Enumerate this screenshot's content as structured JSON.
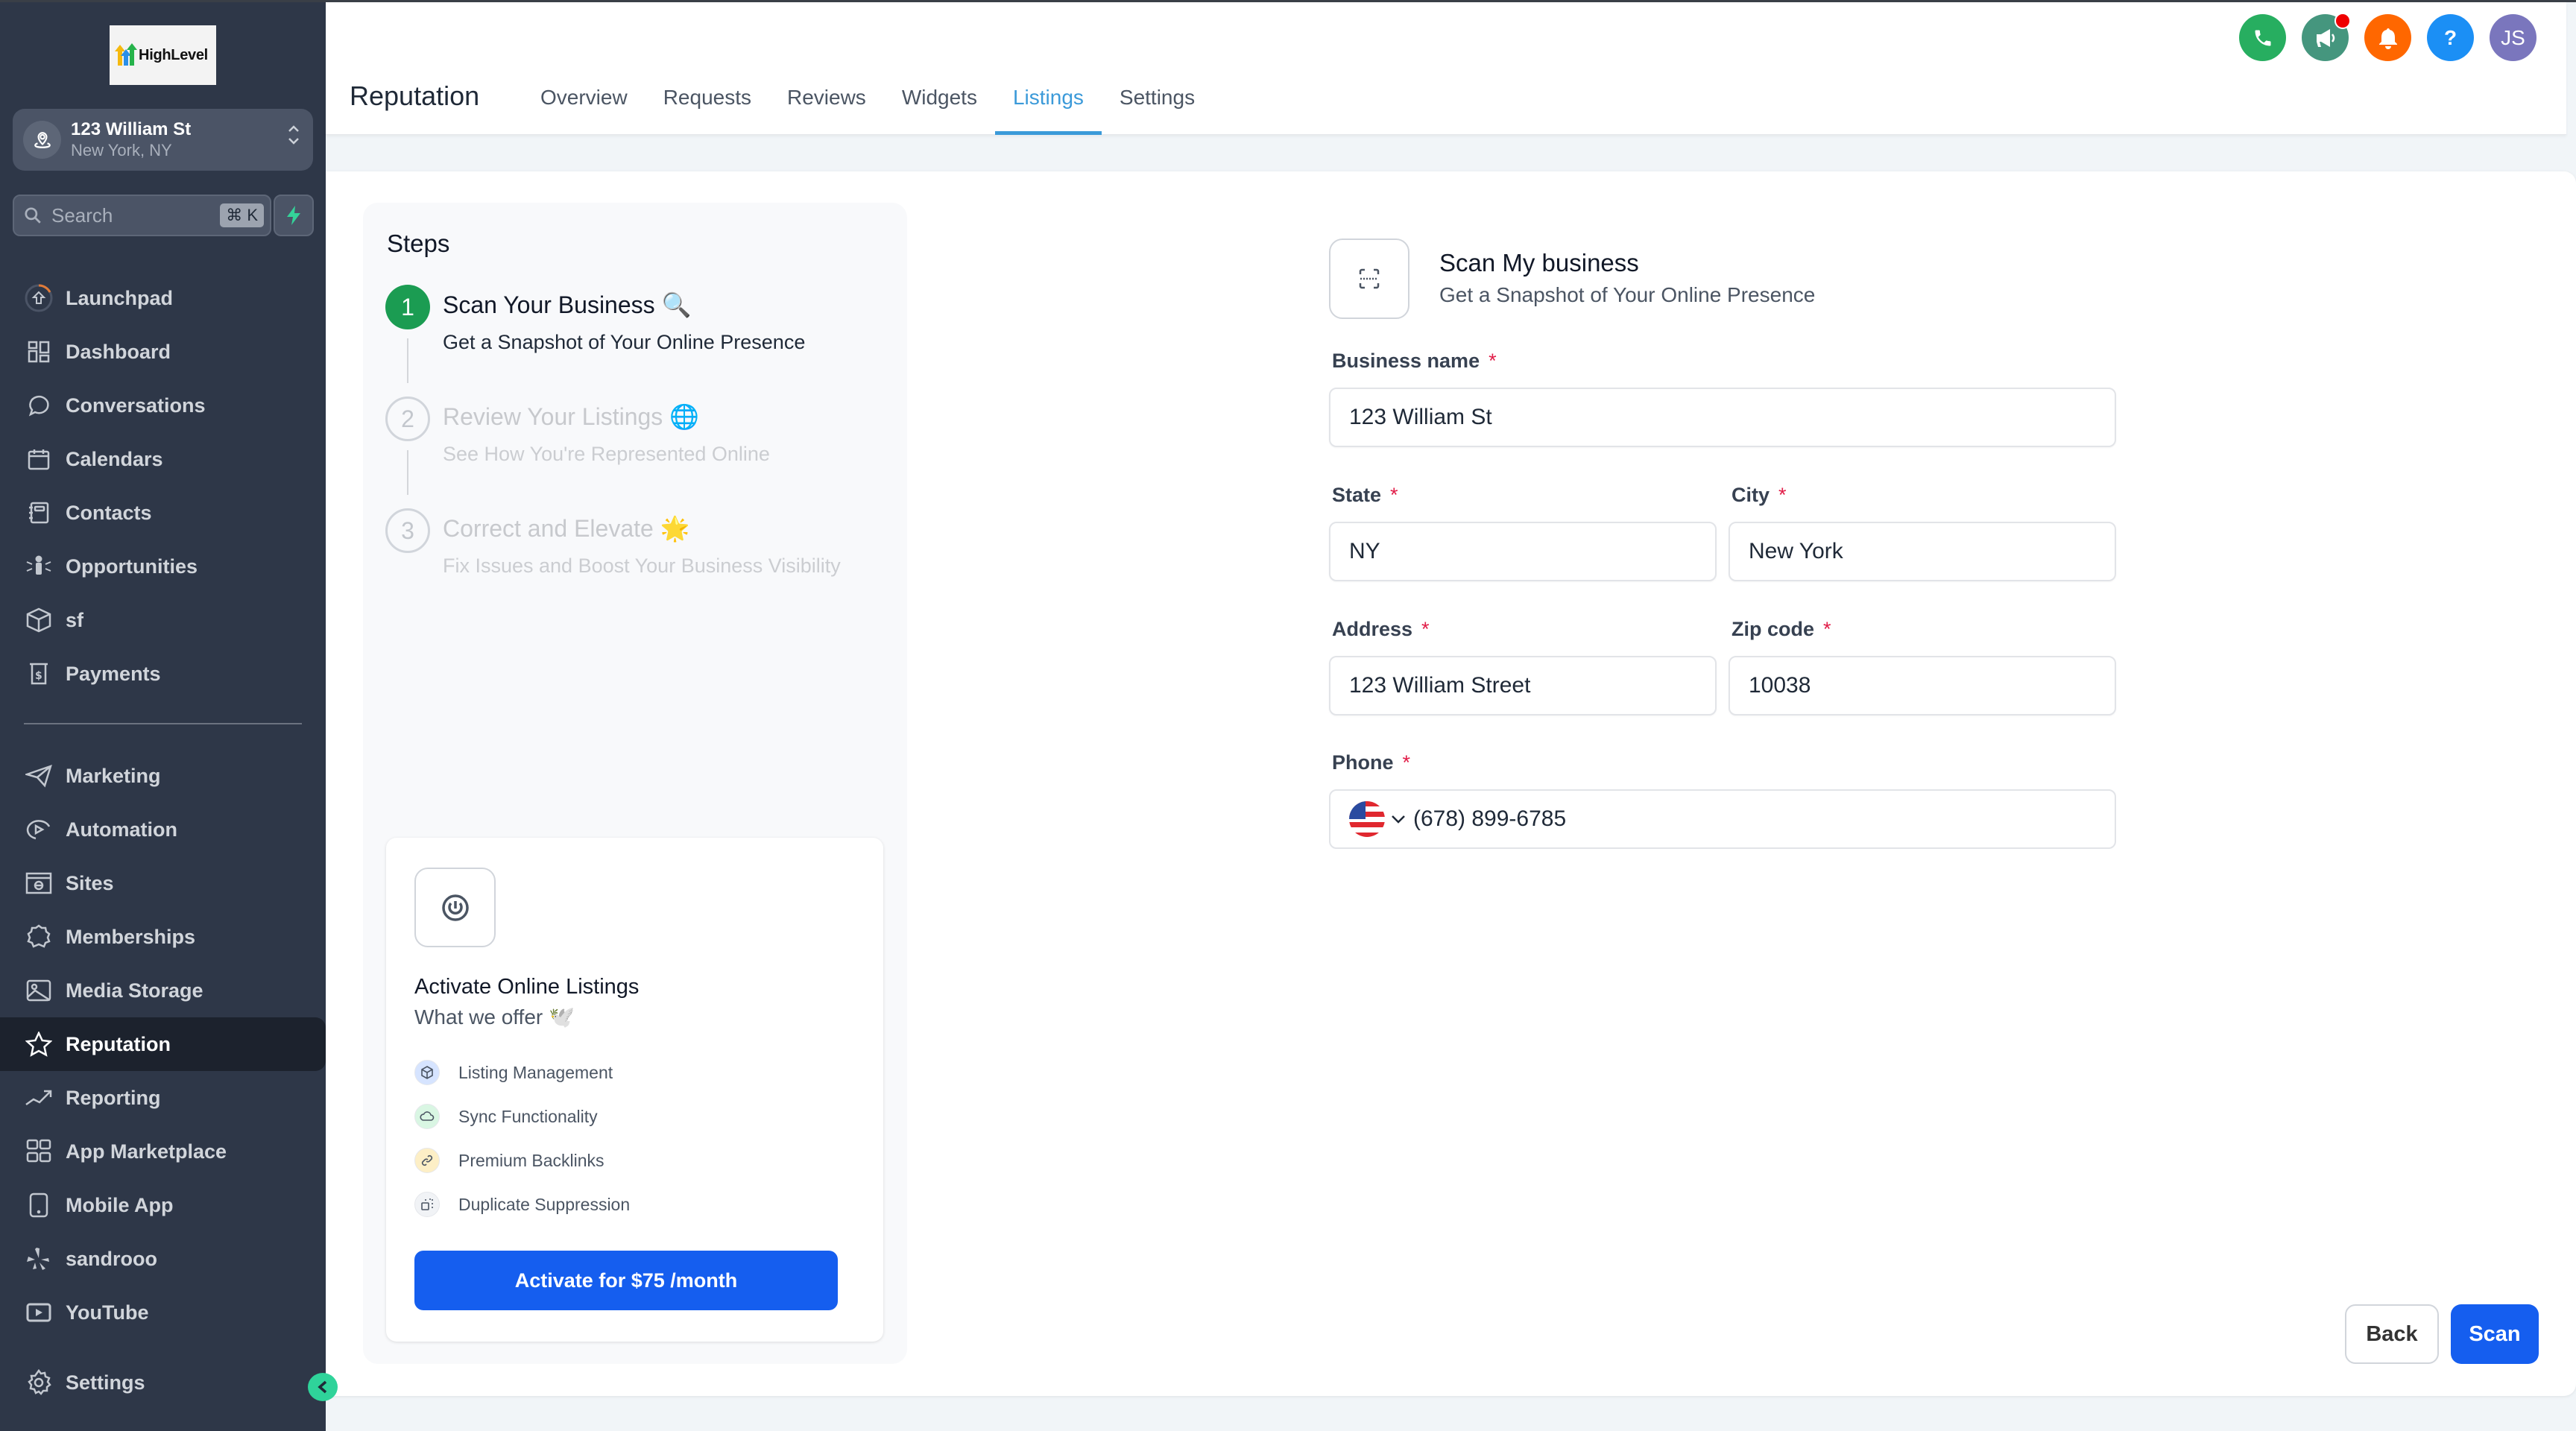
{
  "app": {
    "logo_text": "HighLevel",
    "location": {
      "name": "123 William St",
      "sub": "New York, NY"
    },
    "search": {
      "placeholder": "Search",
      "shortcut": "⌘ K"
    }
  },
  "sidebar": {
    "items": [
      {
        "label": "Launchpad",
        "icon": "launchpad-icon"
      },
      {
        "label": "Dashboard",
        "icon": "dashboard-icon"
      },
      {
        "label": "Conversations",
        "icon": "chat-bubble-icon"
      },
      {
        "label": "Calendars",
        "icon": "calendar-icon"
      },
      {
        "label": "Contacts",
        "icon": "contacts-book-icon"
      },
      {
        "label": "Opportunities",
        "icon": "opportunities-icon"
      },
      {
        "label": "sf",
        "icon": "box-icon"
      },
      {
        "label": "Payments",
        "icon": "payments-icon"
      }
    ],
    "items2": [
      {
        "label": "Marketing",
        "icon": "send-icon"
      },
      {
        "label": "Automation",
        "icon": "automation-icon"
      },
      {
        "label": "Sites",
        "icon": "globe-window-icon"
      },
      {
        "label": "Memberships",
        "icon": "badge-icon"
      },
      {
        "label": "Media Storage",
        "icon": "image-icon"
      },
      {
        "label": "Reputation",
        "icon": "star-icon",
        "active": true
      },
      {
        "label": "Reporting",
        "icon": "trend-icon"
      },
      {
        "label": "App Marketplace",
        "icon": "grid-icon"
      },
      {
        "label": "Mobile App",
        "icon": "mobile-icon"
      },
      {
        "label": "sandrooo",
        "icon": "yelp-icon"
      },
      {
        "label": "YouTube",
        "icon": "youtube-icon"
      }
    ],
    "settings": {
      "label": "Settings",
      "icon": "gear-icon"
    }
  },
  "header": {
    "title": "Reputation",
    "tabs": [
      {
        "label": "Overview"
      },
      {
        "label": "Requests"
      },
      {
        "label": "Reviews"
      },
      {
        "label": "Widgets"
      },
      {
        "label": "Listings",
        "active": true
      },
      {
        "label": "Settings"
      }
    ],
    "actions": {
      "phone_color": "#27ae60",
      "announcement_color": "#45967e",
      "notifications_color": "#ff6700",
      "help_color": "#1b8ff5",
      "help_label": "?",
      "avatar_initials": "JS",
      "avatar_color": "#7a76bd"
    }
  },
  "steps": {
    "title": "Steps",
    "items": [
      {
        "number": "1",
        "title": "Scan Your Business 🔍",
        "desc": "Get a Snapshot of Your Online Presence",
        "state": "active"
      },
      {
        "number": "2",
        "title": "Review Your Listings 🌐",
        "desc": "See How You're Represented Online",
        "state": "inactive"
      },
      {
        "number": "3",
        "title": "Correct and Elevate 🌟",
        "desc": "Fix Issues and Boost Your Business Visibility",
        "state": "inactive"
      }
    ]
  },
  "offer": {
    "title": "Activate Online Listings",
    "subtitle": "What we offer 🕊️",
    "features": [
      {
        "label": "Listing Management",
        "color": "#d6e4ff"
      },
      {
        "label": "Sync Functionality",
        "color": "#d9f6e3"
      },
      {
        "label": "Premium Backlinks",
        "color": "#fdefc6"
      },
      {
        "label": "Duplicate Suppression",
        "color": "#f1f3f6"
      }
    ],
    "cta_label": "Activate for $75 /month"
  },
  "form": {
    "title": "Scan My business",
    "subtitle": "Get a Snapshot of Your Online Presence",
    "required_mark": "*",
    "business_name": {
      "label": "Business name",
      "value": "123 William St"
    },
    "state": {
      "label": "State",
      "value": "NY"
    },
    "city": {
      "label": "City",
      "value": "New York"
    },
    "address": {
      "label": "Address",
      "value": "123 William Street"
    },
    "zip": {
      "label": "Zip code",
      "value": "10038"
    },
    "phone": {
      "label": "Phone",
      "country": "US",
      "value": "(678) 899-6785"
    },
    "back_label": "Back",
    "scan_label": "Scan"
  }
}
